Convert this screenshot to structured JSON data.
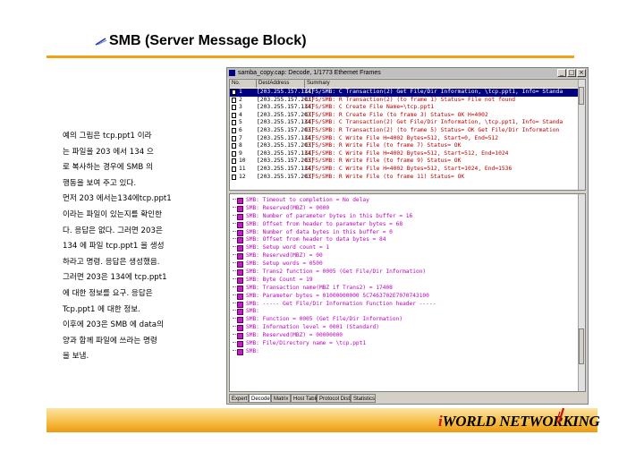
{
  "slide": {
    "title": "SMB (Server Message Block)",
    "lines": [
      "예의 그림은 tcp.ppt1 이라",
      "는 파일을 203 에서 134 으",
      "로 복사하는 경우에 SMB 의",
      "행동을 보여 주고 있다.",
      " 먼저 203 에서는134에tcp.ppt1",
      "이라는 파일이 있는지를 확인한",
      "다. 응답은 없다. 그러면 203은",
      "134 에 파일 tcp.ppt1 을 생성",
      "하라고 명령. 응답은 생성했음.",
      "그러면 203은 134에 tcp.ppt1",
      "에 대한 정보를 요구. 응답은",
      "Tcp.ppt1 에 대한 정보.",
      " 이후에 203은 SMB 에 data의",
      "양과 함께 파일에 쓰라는 명령",
      "을 보냄."
    ],
    "logo_i": "i",
    "logo_rest": "WORLD NETWORKING"
  },
  "window": {
    "title": "samba_copy.cap: Decode, 1/1773 Ethernet Frames",
    "columns": [
      "No.",
      "DestAddress",
      "Summary"
    ],
    "rows": [
      {
        "no": "1",
        "addr": "[203.255.157.134]",
        "summary": "CIFS/SMB: C Transaction(2)  Get File/Dir Information, \\tcp.ppt1, Info= Standa"
      },
      {
        "no": "2",
        "addr": "[203.255.157.203]",
        "summary": "CIFS/SMB: R Transaction(2) (to frame 1) Status= File not found"
      },
      {
        "no": "3",
        "addr": "[203.255.157.134]",
        "summary": "CIFS/SMB: C Create File Name=\\tcp.ppt1"
      },
      {
        "no": "4",
        "addr": "[203.255.157.203]",
        "summary": "CIFS/SMB: R Create File (to frame 3) Status= OK   H=4002"
      },
      {
        "no": "5",
        "addr": "[203.255.157.134]",
        "summary": "CIFS/SMB: C Transaction(2)  Get File/Dir Information, \\tcp.ppt1, Info= Standa"
      },
      {
        "no": "6",
        "addr": "[203.255.157.203]",
        "summary": "CIFS/SMB: R Transaction(2) (to frame 5) Status= OK   Get File/Dir Information"
      },
      {
        "no": "7",
        "addr": "[203.255.157.134]",
        "summary": "CIFS/SMB: C Write File H=4002 Bytes=512, Start=0, End=512"
      },
      {
        "no": "8",
        "addr": "[203.255.157.203]",
        "summary": "CIFS/SMB: R Write File (to frame 7) Status= OK"
      },
      {
        "no": "9",
        "addr": "[203.255.157.134]",
        "summary": "CIFS/SMB: C Write File H=4002 Bytes=512, Start=512, End=1024"
      },
      {
        "no": "10",
        "addr": "[203.255.157.203]",
        "summary": "CIFS/SMB: R Write File (to frame 9) Status= OK"
      },
      {
        "no": "11",
        "addr": "[203.255.157.134]",
        "summary": "CIFS/SMB: C Write File H=4002 Bytes=512, Start=1024, End=1536"
      },
      {
        "no": "12",
        "addr": "[203.255.157.203]",
        "summary": "CIFS/SMB: R Write File (to frame 11) Status= OK"
      }
    ],
    "detail": [
      "SMB: Timeout to completion                  = No delay",
      "SMB: Reserved(MBZ)                          = 0000",
      "SMB: Number of parameter bytes in this buffer = 16",
      "SMB: Offset from header to parameter bytes   = 68",
      "SMB: Number of data bytes in this buffer = 0",
      "SMB: Offset from header to data bytes    = 84",
      "SMB: Setup word count = 1",
      "SMB: Reserved(MBZ)      = 00",
      "SMB: Setup words        = 0500",
      "SMB: Trans2 function    = 0005 (Get File/Dir Information)",
      "SMB: Byte Count                     = 19",
      "SMB: Transaction name(MBZ if Trans2) = 17408",
      "SMB: Parameter bytes  = 01000000000 5C7463702E7070743100",
      "SMB: ----- Get File/Dir Information Function header -----",
      "SMB:",
      "SMB: Function      = 0005 (Get File/Dir Information)",
      "SMB: Information level    = 0001 (Standard)",
      "SMB: Reserved(MBZ)          = 00000000",
      "SMB: File/Directory name = \\tcp.ppt1",
      "SMB:"
    ],
    "tabs": [
      "Expert",
      "Decode",
      "Matrix",
      "Host Table",
      "Protocol Dist.",
      "Statistics"
    ],
    "active_tab": "Decode"
  }
}
